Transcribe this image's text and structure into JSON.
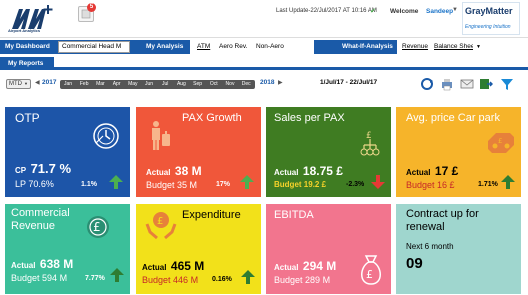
{
  "header": {
    "logo_text": "Airport Analytics",
    "notification_count": "5",
    "last_update": "Last Update-22/Jul/2017 AT 10:16 AM",
    "welcome_label": "Welcome",
    "username": "Sandeep",
    "company_logo": {
      "title": "GrayMatter",
      "tagline": "Engineering Intuition"
    }
  },
  "nav": {
    "my_dashboard_label": "My Dashboard",
    "dashboard_select": "Commercial Head M",
    "my_analysis_label": "My Analysis",
    "analysis_links": [
      "ATM",
      "Aero Rev.",
      "Non-Aero"
    ],
    "what_if_label": "What-If-Analysis",
    "what_if_links": [
      "Revenue",
      "Balance Sheet"
    ],
    "my_reports_label": "My Reports"
  },
  "timeline": {
    "period": "MTD",
    "start_year": "2017",
    "end_year": "2018",
    "months": [
      "Jan",
      "Feb",
      "Mar",
      "Apr",
      "May",
      "Jun",
      "Jul",
      "Aug",
      "Sep",
      "Oct",
      "Nov",
      "Dec"
    ],
    "date_range": "1/Jul/17 - 22/Jul/17"
  },
  "tiles": {
    "otp": {
      "title": "OTP",
      "cp_label": "CP",
      "cp_value": "71.7 %",
      "lp_label": "LP",
      "lp_value": "70.6%",
      "change": "1.1%",
      "color": "#1d55a8"
    },
    "pax_growth": {
      "title": "PAX Growth",
      "actual_label": "Actual",
      "actual_value": "38 M",
      "budget_label": "Budget",
      "budget_value": "35 M",
      "change": "17%",
      "color": "#f0573a"
    },
    "sales_per_pax": {
      "title": "Sales per PAX",
      "actual_label": "Actual",
      "actual_value": "18.75 £",
      "budget_label": "Budget",
      "budget_value": "19.2 £",
      "change": "-2.3%",
      "color": "#3f7c22"
    },
    "car_park": {
      "title": "Avg. price Car park",
      "actual_label": "Actual",
      "actual_value": "17 £",
      "budget_label": "Budget",
      "budget_value": "16 £",
      "change": "1.71%",
      "color": "#f6b42a"
    },
    "commercial_revenue": {
      "title_line1": "Commercial",
      "title_line2": "Revenue",
      "actual_label": "Actual",
      "actual_value": "638 M",
      "budget_label": "Budget",
      "budget_value": "594 M",
      "change": "7.77%",
      "color": "#3bbf9a"
    },
    "expenditure": {
      "title": "Expenditure",
      "actual_label": "Actual",
      "actual_value": "465 M",
      "budget_label": "Budget",
      "budget_value": "446 M",
      "change": "0.16%",
      "color": "#f2e11a"
    },
    "ebitda": {
      "title": "EBITDA",
      "actual_label": "Actual",
      "actual_value": "294 M",
      "budget_label": "Budget",
      "budget_value": "289 M",
      "color": "#f2758e"
    },
    "contract_renewal": {
      "title_line1": "Contract up for",
      "title_line2": "renewal",
      "period_label": "Next 6 month",
      "count": "09",
      "color": "#9fd6ce"
    }
  }
}
